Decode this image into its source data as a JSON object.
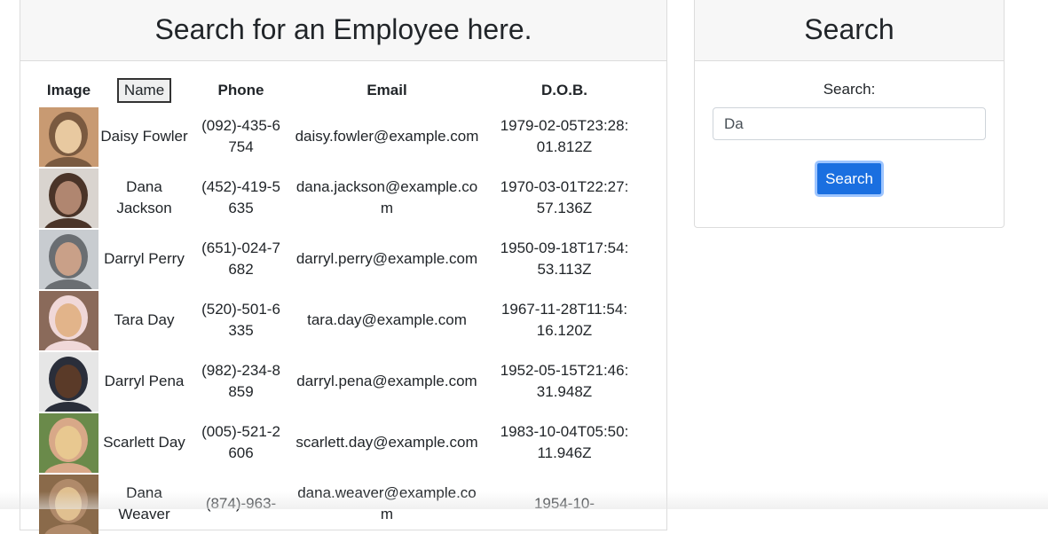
{
  "employees_panel": {
    "title": "Search for an Employee here.",
    "headers": {
      "image": "Image",
      "name": "Name",
      "phone": "Phone",
      "email": "Email",
      "dob": "D.O.B."
    },
    "rows": [
      {
        "name": "Daisy Fowler",
        "phone": "(092)-435-6754",
        "email": "daisy.fowler@example.com",
        "dob": "1979-02-05T23:28:01.812Z",
        "photo_colors": [
          "#c89a72",
          "#e8c9a0",
          "#7a5a40"
        ]
      },
      {
        "name": "Dana Jackson",
        "phone": "(452)-419-5635",
        "email": "dana.jackson@example.com",
        "dob": "1970-03-01T22:27:57.136Z",
        "photo_colors": [
          "#d9d4cf",
          "#b08670",
          "#4a3428"
        ]
      },
      {
        "name": "Darryl Perry",
        "phone": "(651)-024-7682",
        "email": "darryl.perry@example.com",
        "dob": "1950-09-18T17:54:53.113Z",
        "photo_colors": [
          "#c8ccd0",
          "#c9a088",
          "#6a6e72"
        ]
      },
      {
        "name": "Tara Day",
        "phone": "(520)-501-6335",
        "email": "tara.day@example.com",
        "dob": "1967-11-28T11:54:16.120Z",
        "photo_colors": [
          "#8a6a5a",
          "#e2b48a",
          "#f0d8d8"
        ]
      },
      {
        "name": "Darryl Pena",
        "phone": "(982)-234-8859",
        "email": "darryl.pena@example.com",
        "dob": "1952-05-15T21:46:31.948Z",
        "photo_colors": [
          "#e6e6e6",
          "#5a3a28",
          "#2a2e3a"
        ]
      },
      {
        "name": "Scarlett Day",
        "phone": "(005)-521-2606",
        "email": "scarlett.day@example.com",
        "dob": "1983-10-04T05:50:11.946Z",
        "photo_colors": [
          "#6a8a4a",
          "#e8c890",
          "#d8a888"
        ]
      },
      {
        "name": "Dana Weaver",
        "phone": "(874)-963-",
        "email": "dana.weaver@example.com",
        "dob": "1954-10-",
        "photo_colors": [
          "#8a6a4a",
          "#e0c090",
          "#b08a6a"
        ]
      }
    ]
  },
  "search_panel": {
    "title": "Search",
    "label": "Search:",
    "input_value": "Da",
    "button_label": "Search"
  },
  "colors": {
    "primary_button": "#1a6fe0",
    "card_header_bg": "#f7f7f7",
    "border": "#dcdcdc"
  }
}
